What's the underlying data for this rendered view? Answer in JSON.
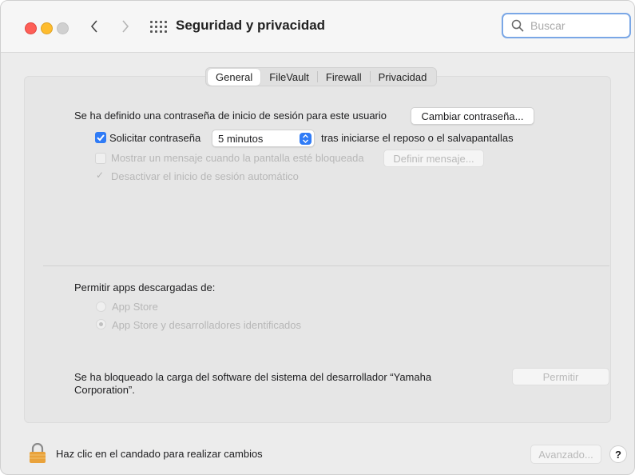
{
  "window": {
    "title": "Seguridad y privacidad",
    "search_placeholder": "Buscar"
  },
  "tabs": [
    {
      "label": "General",
      "active": true
    },
    {
      "label": "FileVault",
      "active": false
    },
    {
      "label": "Firewall",
      "active": false
    },
    {
      "label": "Privacidad",
      "active": false
    }
  ],
  "general": {
    "password_text": "Se ha definido una contraseña de inicio de sesión para este usuario",
    "change_password_button": "Cambiar contraseña...",
    "require_password": {
      "label": "Solicitar contraseña",
      "checked": true,
      "selected_value": "5 minutos",
      "suffix": "tras iniciarse el reposo o el salvapantallas"
    },
    "show_message": {
      "label": "Mostrar un mensaje cuando la pantalla esté bloqueada",
      "checked": false,
      "button": "Definir mensaje..."
    },
    "disable_autologin": {
      "label": "Desactivar el inicio de sesión automático",
      "checked": true
    },
    "allow_apps": {
      "heading": "Permitir apps descargadas de:",
      "options": [
        {
          "label": "App Store",
          "selected": false
        },
        {
          "label": "App Store y desarrolladores identificados",
          "selected": true
        }
      ]
    },
    "blocked_software": {
      "text_line1": "Se ha bloqueado la carga del software del sistema del desarrollador “Yamaha",
      "text_line2": "Corporation”.",
      "allow_button": "Permitir"
    }
  },
  "footer": {
    "lock_text": "Haz clic en el candado para realizar cambios",
    "advanced_button": "Avanzado...",
    "help_button": "?"
  },
  "colors": {
    "accent": "#2f7bf6",
    "close": "#fe5f57",
    "minimize": "#febc2e",
    "lock": "#e9a23b"
  }
}
